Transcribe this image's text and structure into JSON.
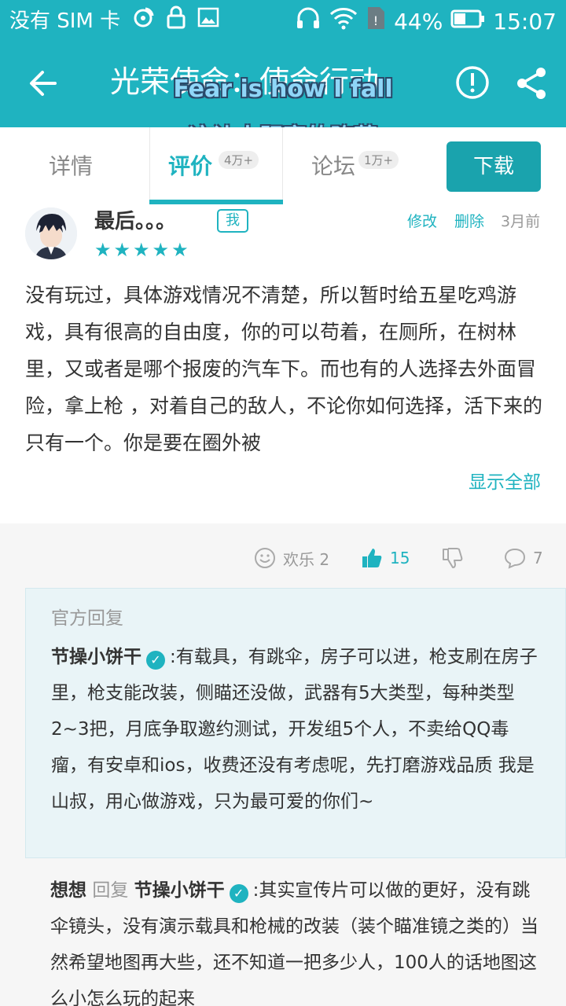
{
  "status_bar": {
    "carrier": "没有 SIM 卡",
    "battery": "44%",
    "time": "15:07"
  },
  "app_bar": {
    "title": "光荣使命：使命行动",
    "back_icon": "arrow-left-icon",
    "report_icon": "alert-circle-icon",
    "share_icon": "share-icon"
  },
  "overlay": {
    "line1": "Fear is how I fall",
    "line2": "这让人胆寒的堕落"
  },
  "tabs": {
    "details": "详情",
    "reviews": "评价",
    "reviews_count": "4万+",
    "forum": "论坛",
    "forum_count": "1万+",
    "download": "下载",
    "active": "reviews"
  },
  "review": {
    "username": "最后。。。",
    "me_badge": "我",
    "rating": 5,
    "stars": "★★★★★",
    "edit": "修改",
    "delete": "删除",
    "time": "3月前",
    "body": "没有玩过，具体游戏情况不清楚，所以暂时给五星吃鸡游戏，具有很高的自由度，你的可以苟着，在厕所，在树林里，又或者是哪个报废的汽车下。而也有的人选择去外面冒险，拿上枪 ，对着自己的敌人，不论你如何选择，活下来的只有一个。你是要在圈外被",
    "show_all": "显示全部"
  },
  "actions": {
    "fun_label": "欢乐 2",
    "likes": "15",
    "comments": "7"
  },
  "official_reply": {
    "label": "官方回复",
    "author": "节操小饼干",
    "text": ":有载具，有跳伞，房子可以进，枪支刷在房子里，枪支能改装，侧瞄还没做，武器有5大类型，每种类型2~3把，月底争取邀约测试，开发组5个人，不卖给QQ毒瘤，有安卓和ios，收费还没有考虑呢，先打磨游戏品质 我是山叔，用心做游戏，只为最可爱的你们~"
  },
  "user_reply": {
    "author": "想想",
    "reply_word": "回复",
    "target": "节操小饼干",
    "text": ":其实宣传片可以做的更好，没有跳伞镜头，没有演示载具和枪械的改装（装个瞄准镜之类的）当然希望地图再大些，还不知道一把多少人，100人的话地图这么小怎么玩的起来"
  },
  "colors": {
    "accent": "#1fb3c0",
    "download_bg": "#1aa3ad",
    "official_bg": "#e9f4f7"
  }
}
